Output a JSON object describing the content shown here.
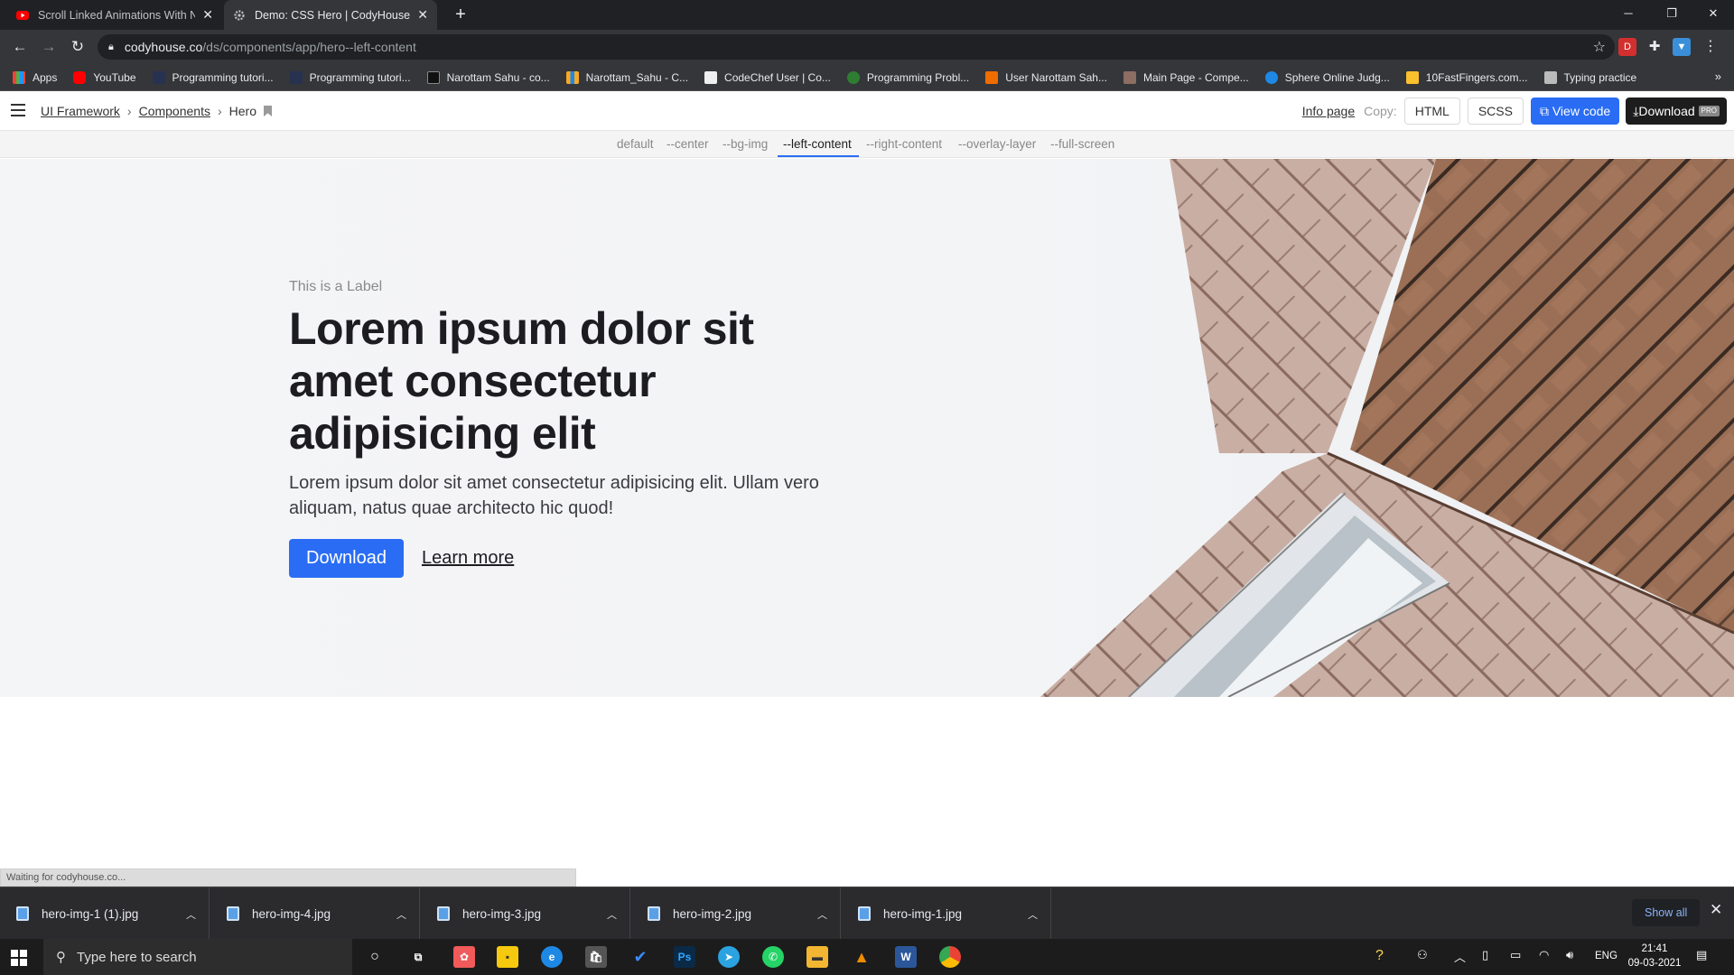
{
  "browser": {
    "tabs": [
      {
        "title": "Scroll Linked Animations With N",
        "active": false
      },
      {
        "title": "Demo: CSS Hero | CodyHouse",
        "active": true
      }
    ],
    "url_host": "codyhouse.co",
    "url_path": "/ds/components/app/hero--left-content",
    "bookmarks": [
      "Apps",
      "YouTube",
      "Programming tutori...",
      "Programming tutori...",
      "Narottam Sahu - co...",
      "Narottam_Sahu - C...",
      "CodeChef User | Co...",
      "Programming Probl...",
      "User Narottam Sah...",
      "Main Page - Compe...",
      "Sphere Online Judg...",
      "10FastFingers.com...",
      "Typing practice"
    ],
    "bookmarks_more": "»",
    "status_text": "Waiting for codyhouse.co..."
  },
  "topbar": {
    "breadcrumb": [
      "UI Framework",
      "Components",
      "Hero"
    ],
    "info_page": "Info page",
    "copy_label": "Copy:",
    "html_btn": "HTML",
    "scss_btn": "SCSS",
    "view_code_btn": "View code",
    "download_btn": "Download",
    "pro_badge": "PRO"
  },
  "variants": {
    "tabs": [
      "default",
      "--center",
      "--bg-img",
      "--left-content",
      "--right-content",
      "--overlay-layer",
      "--full-screen"
    ],
    "active": "--left-content"
  },
  "hero": {
    "label": "This is a Label",
    "headline": "Lorem ipsum dolor sit amet consectetur adipisicing elit",
    "paragraph": "Lorem ipsum dolor sit amet consectetur adipisicing elit. Ullam vero aliquam, natus quae architecto hic quod!",
    "primary_cta": "Download",
    "secondary_cta": "Learn more"
  },
  "downloads": {
    "items": [
      "hero-img-1 (1).jpg",
      "hero-img-4.jpg",
      "hero-img-3.jpg",
      "hero-img-2.jpg",
      "hero-img-1.jpg"
    ],
    "show_all": "Show all"
  },
  "taskbar": {
    "search_placeholder": "Type here to search",
    "language": "ENG",
    "time": "21:41",
    "date": "09-03-2021"
  },
  "colors": {
    "accent": "#2a6df4",
    "dark": "#1d1d21",
    "chrome_bg": "#202124"
  }
}
